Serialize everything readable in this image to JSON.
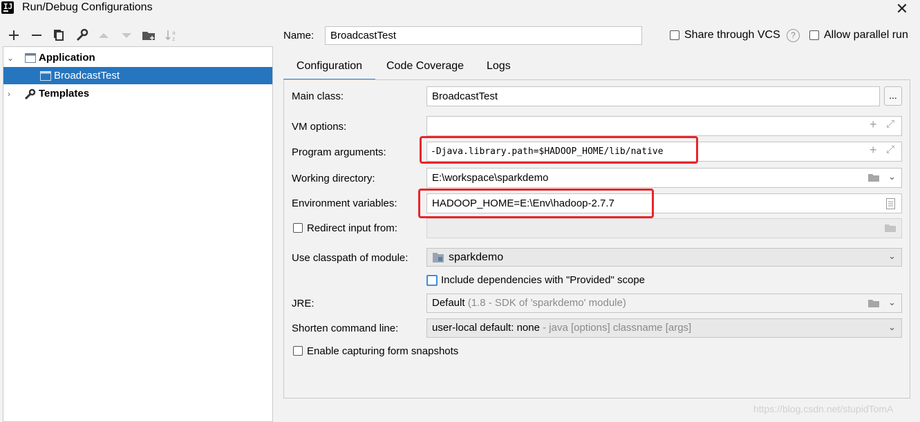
{
  "window": {
    "title": "Run/Debug Configurations",
    "app_icon_label": "IJ"
  },
  "toolbar": {
    "icons": [
      "add-icon",
      "remove-icon",
      "copy-icon",
      "wrench-icon",
      "move-up-icon",
      "move-down-icon",
      "folder-icon",
      "sort-icon"
    ]
  },
  "tree": {
    "application_label": "Application",
    "child_label": "BroadcastTest",
    "templates_label": "Templates"
  },
  "header": {
    "name_label": "Name:",
    "name_value": "BroadcastTest",
    "share_vcs_label": "Share through VCS",
    "share_vcs_checked": false,
    "allow_parallel_label": "Allow parallel run",
    "allow_parallel_checked": false
  },
  "tabs": [
    {
      "label": "Configuration",
      "active": true
    },
    {
      "label": "Code Coverage",
      "active": false
    },
    {
      "label": "Logs",
      "active": false
    }
  ],
  "form": {
    "main_class_label": "Main class:",
    "main_class_value": "BroadcastTest",
    "ellipsis": "...",
    "vm_options_label": "VM options:",
    "vm_options_value": "",
    "program_args_label": "Program arguments:",
    "program_args_value": "-Djava.library.path=$HADOOP_HOME/lib/native",
    "working_dir_label": "Working directory:",
    "working_dir_value": "E:\\workspace\\sparkdemo",
    "env_vars_label": "Environment variables:",
    "env_vars_value": "HADOOP_HOME=E:\\Env\\hadoop-2.7.7",
    "redirect_label": "Redirect input from:",
    "redirect_checked": false,
    "classpath_label": "Use classpath of module:",
    "classpath_value": "sparkdemo",
    "include_deps_label": "Include dependencies with \"Provided\" scope",
    "include_deps_checked": false,
    "jre_label": "JRE:",
    "jre_value": "Default",
    "jre_hint": "(1.8 - SDK of 'sparkdemo' module)",
    "shorten_label": "Shorten command line:",
    "shorten_value": "user-local default: none",
    "shorten_hint": "- java [options] classname [args]",
    "capture_label": "Enable capturing form snapshots",
    "capture_checked": false
  },
  "watermark": "https://blog.csdn.net/stupidTomA",
  "colors": {
    "selection": "#2675bf",
    "tab_underline": "#4083c9",
    "highlight_box": "#e8252a"
  }
}
